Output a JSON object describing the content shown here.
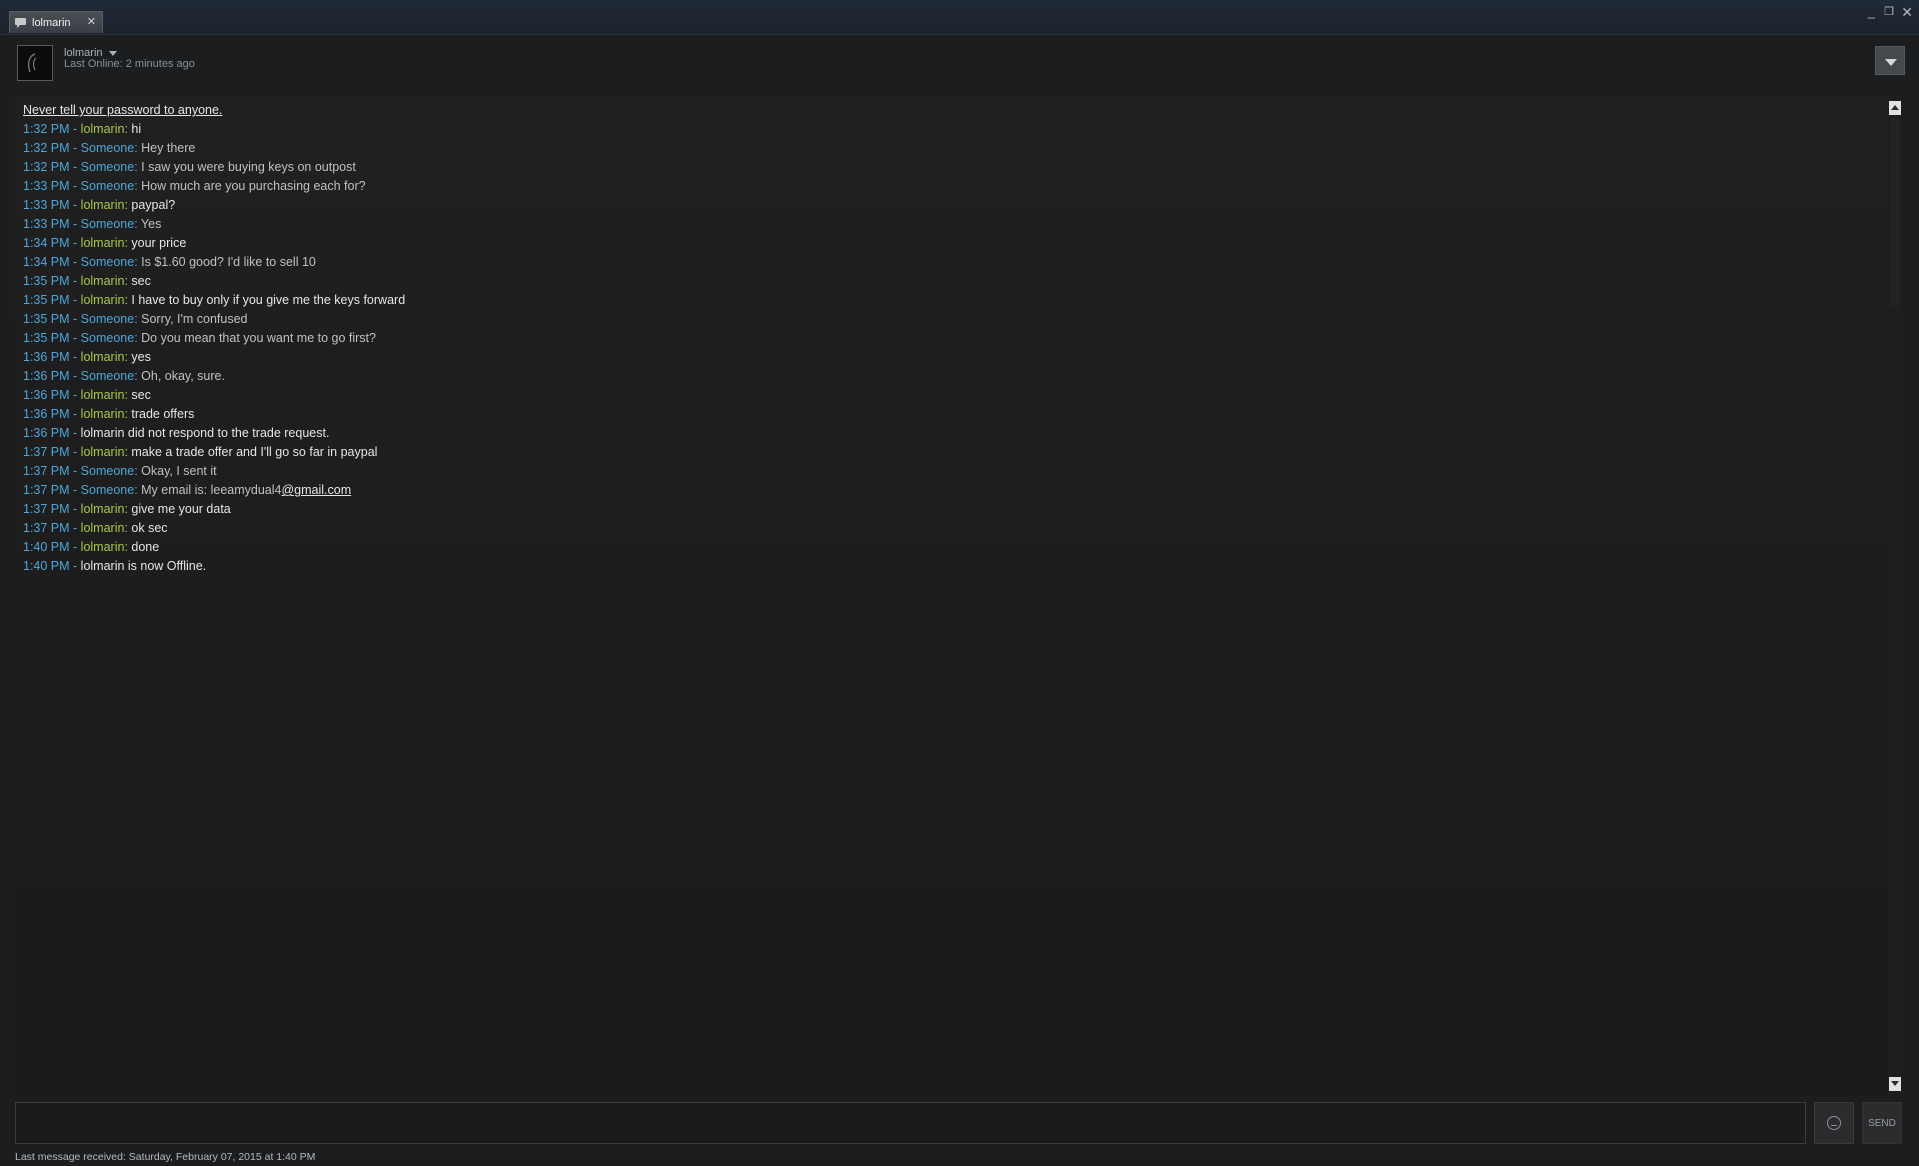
{
  "window": {
    "tab_title": "lolmarin",
    "tab_close": "✕",
    "controls": {
      "minimize": "_",
      "maximize": "❐",
      "close": "✕"
    }
  },
  "header": {
    "friend_name": "lolmarin",
    "last_online": "Last Online: 2 minutes ago"
  },
  "chat": {
    "warning": "Never tell your password to anyone.",
    "messages": [
      {
        "time": "1:32 PM",
        "sender": "lolmarin",
        "self": true,
        "text": "hi"
      },
      {
        "time": "1:32 PM",
        "sender": "Someone",
        "self": false,
        "text": "Hey there"
      },
      {
        "time": "1:32 PM",
        "sender": "Someone",
        "self": false,
        "text": "I saw you were buying keys on outpost"
      },
      {
        "time": "1:33 PM",
        "sender": "Someone",
        "self": false,
        "text": "How much are you purchasing each for?"
      },
      {
        "time": "1:33 PM",
        "sender": "lolmarin",
        "self": true,
        "text": "paypal?"
      },
      {
        "time": "1:33 PM",
        "sender": "Someone",
        "self": false,
        "text": "Yes"
      },
      {
        "time": "1:34 PM",
        "sender": "lolmarin",
        "self": true,
        "text": "your price"
      },
      {
        "time": "1:34 PM",
        "sender": "Someone",
        "self": false,
        "text": "Is $1.60 good? I'd like to sell 10"
      },
      {
        "time": "1:35 PM",
        "sender": "lolmarin",
        "self": true,
        "text": "sec"
      },
      {
        "time": "1:35 PM",
        "sender": "lolmarin",
        "self": true,
        "text": "I have to buy only if you give me the keys forward"
      },
      {
        "time": "1:35 PM",
        "sender": "Someone",
        "self": false,
        "text": "Sorry, I'm confused"
      },
      {
        "time": "1:35 PM",
        "sender": "Someone",
        "self": false,
        "text": "Do you mean that you want me to go first?"
      },
      {
        "time": "1:36 PM",
        "sender": "lolmarin",
        "self": true,
        "text": "yes"
      },
      {
        "time": "1:36 PM",
        "sender": "Someone",
        "self": false,
        "text": "Oh, okay, sure."
      },
      {
        "time": "1:36 PM",
        "sender": "lolmarin",
        "self": true,
        "text": "sec"
      },
      {
        "time": "1:36 PM",
        "sender": "lolmarin",
        "self": true,
        "text": "trade offers"
      },
      {
        "time": "1:36 PM",
        "status": "lolmarin did not respond to the trade request."
      },
      {
        "time": "1:37 PM",
        "sender": "lolmarin",
        "self": true,
        "text": "make a trade offer and I'll go so far in paypal"
      },
      {
        "time": "1:37 PM",
        "sender": "Someone",
        "self": false,
        "text": "Okay, I sent it"
      },
      {
        "time": "1:37 PM",
        "sender": "Someone",
        "self": false,
        "text": "My email is: leeamydual4",
        "link": "@gmail.com"
      },
      {
        "time": "1:37 PM",
        "sender": "lolmarin",
        "self": true,
        "text": "give me your data"
      },
      {
        "time": "1:37 PM",
        "sender": "lolmarin",
        "self": true,
        "text": "ok sec"
      },
      {
        "time": "1:40 PM",
        "sender": "lolmarin",
        "self": true,
        "text": "done"
      },
      {
        "time": "1:40 PM",
        "status": "lolmarin is now Offline."
      }
    ]
  },
  "input": {
    "value": "",
    "send_label": "SEND"
  },
  "footer": {
    "last_received": "Last message received: Saturday, February 07, 2015 at 1:40 PM"
  },
  "colors": {
    "timestamp": "#4fa6d8",
    "self_name": "#a7c94a",
    "other_name": "#4fa6d8",
    "background": "#1c1d1f"
  }
}
